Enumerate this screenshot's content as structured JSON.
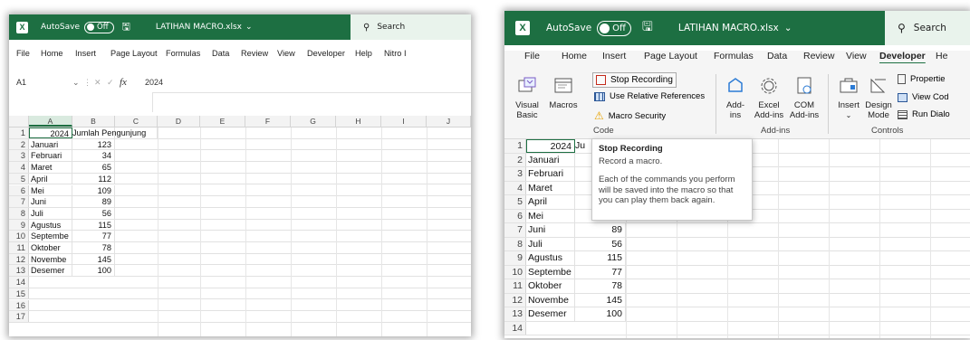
{
  "left": {
    "title": {
      "autosave": "AutoSave",
      "toggle": "Off",
      "file_name": "LATIHAN MACRO.xlsx",
      "dropdown": "⌄",
      "search": "Search"
    },
    "menu": [
      "File",
      "Home",
      "Insert",
      "Page Layout",
      "Formulas",
      "Data",
      "Review",
      "View",
      "Developer",
      "Help",
      "Nitro I"
    ],
    "formula_bar": {
      "name_box": "A1",
      "fx": "fx",
      "value": "2024"
    },
    "columns": [
      "A",
      "B",
      "C",
      "D",
      "E",
      "F",
      "G",
      "H",
      "I",
      "J"
    ],
    "row_numbers": [
      "1",
      "2",
      "3",
      "4",
      "5",
      "6",
      "7",
      "8",
      "9",
      "10",
      "11",
      "12",
      "13",
      "14",
      "15",
      "16",
      "17"
    ],
    "header_row": {
      "a": "2024",
      "b": "Jumlah Pengunjung"
    },
    "rows": [
      {
        "month": "Januari",
        "value": "123"
      },
      {
        "month": "Februari",
        "value": "34"
      },
      {
        "month": "Maret",
        "value": "65"
      },
      {
        "month": "April",
        "value": "112"
      },
      {
        "month": "Mei",
        "value": "109"
      },
      {
        "month": "Juni",
        "value": "89"
      },
      {
        "month": "Juli",
        "value": "56"
      },
      {
        "month": "Agustus",
        "value": "115"
      },
      {
        "month": "Septembe",
        "value": "77"
      },
      {
        "month": "Oktober",
        "value": "78"
      },
      {
        "month": "Novembe",
        "value": "145"
      },
      {
        "month": "Desemer",
        "value": "100"
      }
    ]
  },
  "right": {
    "title": {
      "autosave": "AutoSave",
      "toggle": "Off",
      "file_name": "LATIHAN MACRO.xlsx",
      "dropdown": "⌄",
      "search": "Search"
    },
    "menu": [
      "File",
      "Home",
      "Insert",
      "Page Layout",
      "Formulas",
      "Data",
      "Review",
      "View",
      "Developer",
      "He"
    ],
    "ribbon": {
      "visual_basic": "Visual Basic",
      "macros": "Macros",
      "stop_recording": "Stop Recording",
      "use_relative": "Use Relative References",
      "macro_security": "Macro Security",
      "code_label": "Code",
      "add_ins": "Add-ins",
      "excel_add_ins": "Excel Add-ins",
      "com_add_ins": "COM Add-ins",
      "add_ins_label": "Add-ins",
      "insert": "Insert",
      "design_mode": "Design Mode",
      "properties": "Propertie",
      "view_code": "View Cod",
      "run_dialog": "Run Dialo",
      "controls_label": "Controls"
    },
    "tooltip": {
      "title": "Stop Recording",
      "line1": "Record a macro.",
      "body": "Each of the commands you perform will be saved into the macro so that you can play them back again."
    },
    "row_numbers": [
      "1",
      "2",
      "3",
      "4",
      "5",
      "6",
      "7",
      "8",
      "9",
      "10",
      "11",
      "12",
      "13",
      "14"
    ],
    "header_row": {
      "a": "2024",
      "b": "Ju"
    },
    "rows": [
      {
        "month": "Januari",
        "value": ""
      },
      {
        "month": "Februari",
        "value": ""
      },
      {
        "month": "Maret",
        "value": ""
      },
      {
        "month": "April",
        "value": ""
      },
      {
        "month": "Mei",
        "value": ""
      },
      {
        "month": "Juni",
        "value": "89"
      },
      {
        "month": "Juli",
        "value": "56"
      },
      {
        "month": "Agustus",
        "value": "115"
      },
      {
        "month": "Septembe",
        "value": "77"
      },
      {
        "month": "Oktober",
        "value": "78"
      },
      {
        "month": "Novembe",
        "value": "145"
      },
      {
        "month": "Desemer",
        "value": "100"
      }
    ]
  },
  "colors": {
    "excel_green": "#1d6f42",
    "record_red": "#c42b1c"
  }
}
